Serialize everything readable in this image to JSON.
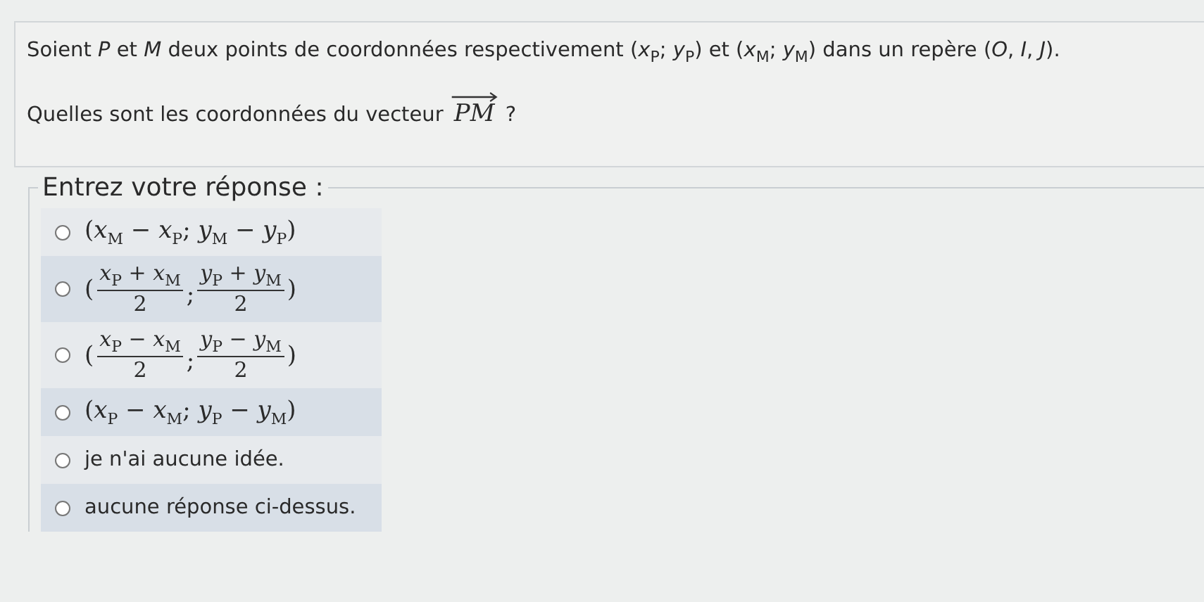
{
  "question": {
    "statement": "Soient *P* et *M* deux points de coordonnées respectivement (*x*$_{P}$; *y*$_{P}$) et (*x*$_{M}$; *y*$_{M}$) dans un repère (*O*, *I*, *J*).",
    "prompt": "Quelles sont les coordonnées du vecteur",
    "vector": "PM",
    "end": "?"
  },
  "answer": {
    "legend": "Entrez votre réponse :",
    "options": [
      {
        "kind": "math",
        "label": "(*x*$_{M}$ − *x*$_{P}$; *y*$_{M}$ − *y*$_{P}$)",
        "selected": false
      },
      {
        "kind": "fraction",
        "open": "(",
        "left": {
          "numerator": "*x*$_{P}$ + *x*$_{M}$",
          "denominator": "2"
        },
        "separator": ";",
        "right": {
          "numerator": "*y*$_{P}$ + *y*$_{M}$",
          "denominator": "2"
        },
        "close": ")",
        "selected": false
      },
      {
        "kind": "fraction",
        "open": "(",
        "left": {
          "numerator": "*x*$_{P}$ − *x*$_{M}$",
          "denominator": "2"
        },
        "separator": ";",
        "right": {
          "numerator": "*y*$_{P}$ − *y*$_{M}$",
          "denominator": "2"
        },
        "close": ")",
        "selected": false
      },
      {
        "kind": "math",
        "label": "(*x*$_{P}$ − *x*$_{M}$; *y*$_{P}$ − *y*$_{M}$)",
        "selected": false
      },
      {
        "kind": "text",
        "label": "je n'ai aucune idée.",
        "selected": false
      },
      {
        "kind": "text",
        "label": "aucune réponse ci-dessus.",
        "selected": false
      }
    ]
  }
}
